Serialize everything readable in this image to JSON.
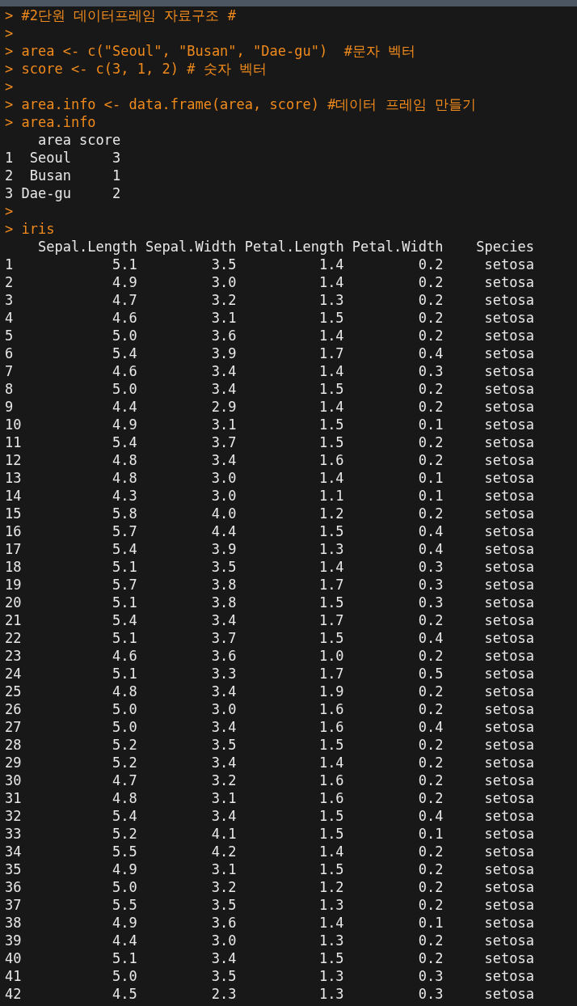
{
  "console": [
    {
      "kind": "command",
      "prompt": ">",
      "code": "#2단원 데이터프레임 자료구조 #"
    },
    {
      "kind": "command",
      "prompt": ">"
    },
    {
      "kind": "command",
      "prompt": ">",
      "code": "area <- c(\"Seoul\", \"Busan\", \"Dae-gu\")  #문자 벡터"
    },
    {
      "kind": "command",
      "prompt": ">",
      "code": "score <- c(3, 1, 2) # 숫자 벡터"
    },
    {
      "kind": "command",
      "prompt": ">"
    },
    {
      "kind": "command",
      "prompt": ">",
      "code": "area.info <- data.frame(area, score) #데이터 프레임 만들기"
    },
    {
      "kind": "command",
      "prompt": ">",
      "code": "area.info"
    },
    {
      "kind": "table",
      "columns": [
        "",
        "area",
        "score"
      ],
      "rows": [
        [
          "1",
          "Seoul",
          "3"
        ],
        [
          "2",
          "Busan",
          "1"
        ],
        [
          "3",
          "Dae-gu",
          "2"
        ]
      ]
    },
    {
      "kind": "command",
      "prompt": ">"
    },
    {
      "kind": "command",
      "prompt": ">",
      "code": "iris"
    },
    {
      "kind": "table",
      "columns": [
        "",
        "Sepal.Length",
        "Sepal.Width",
        "Petal.Length",
        "Petal.Width",
        "Species"
      ],
      "rows": [
        [
          "1",
          "5.1",
          "3.5",
          "1.4",
          "0.2",
          "setosa"
        ],
        [
          "2",
          "4.9",
          "3.0",
          "1.4",
          "0.2",
          "setosa"
        ],
        [
          "3",
          "4.7",
          "3.2",
          "1.3",
          "0.2",
          "setosa"
        ],
        [
          "4",
          "4.6",
          "3.1",
          "1.5",
          "0.2",
          "setosa"
        ],
        [
          "5",
          "5.0",
          "3.6",
          "1.4",
          "0.2",
          "setosa"
        ],
        [
          "6",
          "5.4",
          "3.9",
          "1.7",
          "0.4",
          "setosa"
        ],
        [
          "7",
          "4.6",
          "3.4",
          "1.4",
          "0.3",
          "setosa"
        ],
        [
          "8",
          "5.0",
          "3.4",
          "1.5",
          "0.2",
          "setosa"
        ],
        [
          "9",
          "4.4",
          "2.9",
          "1.4",
          "0.2",
          "setosa"
        ],
        [
          "10",
          "4.9",
          "3.1",
          "1.5",
          "0.1",
          "setosa"
        ],
        [
          "11",
          "5.4",
          "3.7",
          "1.5",
          "0.2",
          "setosa"
        ],
        [
          "12",
          "4.8",
          "3.4",
          "1.6",
          "0.2",
          "setosa"
        ],
        [
          "13",
          "4.8",
          "3.0",
          "1.4",
          "0.1",
          "setosa"
        ],
        [
          "14",
          "4.3",
          "3.0",
          "1.1",
          "0.1",
          "setosa"
        ],
        [
          "15",
          "5.8",
          "4.0",
          "1.2",
          "0.2",
          "setosa"
        ],
        [
          "16",
          "5.7",
          "4.4",
          "1.5",
          "0.4",
          "setosa"
        ],
        [
          "17",
          "5.4",
          "3.9",
          "1.3",
          "0.4",
          "setosa"
        ],
        [
          "18",
          "5.1",
          "3.5",
          "1.4",
          "0.3",
          "setosa"
        ],
        [
          "19",
          "5.7",
          "3.8",
          "1.7",
          "0.3",
          "setosa"
        ],
        [
          "20",
          "5.1",
          "3.8",
          "1.5",
          "0.3",
          "setosa"
        ],
        [
          "21",
          "5.4",
          "3.4",
          "1.7",
          "0.2",
          "setosa"
        ],
        [
          "22",
          "5.1",
          "3.7",
          "1.5",
          "0.4",
          "setosa"
        ],
        [
          "23",
          "4.6",
          "3.6",
          "1.0",
          "0.2",
          "setosa"
        ],
        [
          "24",
          "5.1",
          "3.3",
          "1.7",
          "0.5",
          "setosa"
        ],
        [
          "25",
          "4.8",
          "3.4",
          "1.9",
          "0.2",
          "setosa"
        ],
        [
          "26",
          "5.0",
          "3.0",
          "1.6",
          "0.2",
          "setosa"
        ],
        [
          "27",
          "5.0",
          "3.4",
          "1.6",
          "0.4",
          "setosa"
        ],
        [
          "28",
          "5.2",
          "3.5",
          "1.5",
          "0.2",
          "setosa"
        ],
        [
          "29",
          "5.2",
          "3.4",
          "1.4",
          "0.2",
          "setosa"
        ],
        [
          "30",
          "4.7",
          "3.2",
          "1.6",
          "0.2",
          "setosa"
        ],
        [
          "31",
          "4.8",
          "3.1",
          "1.6",
          "0.2",
          "setosa"
        ],
        [
          "32",
          "5.4",
          "3.4",
          "1.5",
          "0.4",
          "setosa"
        ],
        [
          "33",
          "5.2",
          "4.1",
          "1.5",
          "0.1",
          "setosa"
        ],
        [
          "34",
          "5.5",
          "4.2",
          "1.4",
          "0.2",
          "setosa"
        ],
        [
          "35",
          "4.9",
          "3.1",
          "1.5",
          "0.2",
          "setosa"
        ],
        [
          "36",
          "5.0",
          "3.2",
          "1.2",
          "0.2",
          "setosa"
        ],
        [
          "37",
          "5.5",
          "3.5",
          "1.3",
          "0.2",
          "setosa"
        ],
        [
          "38",
          "4.9",
          "3.6",
          "1.4",
          "0.1",
          "setosa"
        ],
        [
          "39",
          "4.4",
          "3.0",
          "1.3",
          "0.2",
          "setosa"
        ],
        [
          "40",
          "5.1",
          "3.4",
          "1.5",
          "0.2",
          "setosa"
        ],
        [
          "41",
          "5.0",
          "3.5",
          "1.3",
          "0.3",
          "setosa"
        ],
        [
          "42",
          "4.5",
          "2.3",
          "1.3",
          "0.3",
          "setosa"
        ]
      ]
    }
  ]
}
